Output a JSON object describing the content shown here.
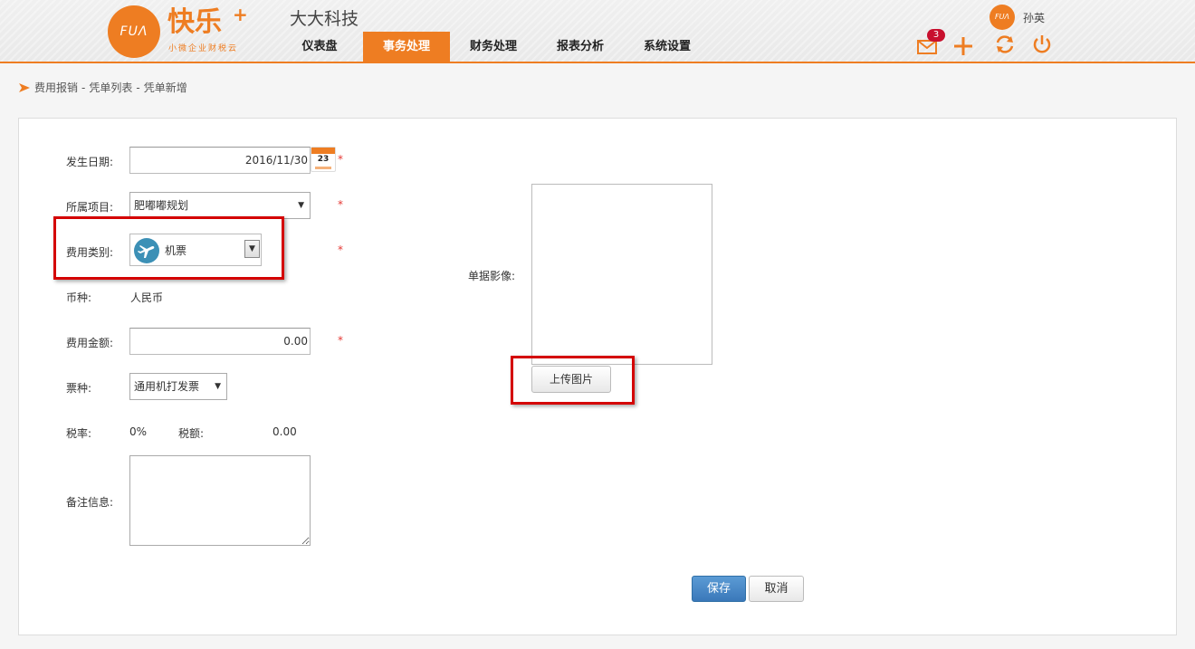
{
  "header": {
    "logo_mark": "FUΛ",
    "logo_text": "快乐",
    "logo_plus": "+",
    "logo_sub": "小微企业财税云",
    "company": "大大科技",
    "nav": [
      {
        "label": "仪表盘",
        "active": false
      },
      {
        "label": "事务处理",
        "active": true
      },
      {
        "label": "财务处理",
        "active": false
      },
      {
        "label": "报表分析",
        "active": false
      },
      {
        "label": "系统设置",
        "active": false
      }
    ],
    "user_avatar": "FUΛ",
    "user_name": "孙英",
    "mail_count": "3",
    "accent_color": "#ee7d22"
  },
  "breadcrumb": {
    "items": [
      "费用报销",
      "凭单列表",
      "凭单新增"
    ],
    "separator": "-"
  },
  "form": {
    "date_label": "发生日期:",
    "date_value": "2016/11/30",
    "calendar_day": "23",
    "project_label": "所属项目:",
    "project_value": "肥嘟嘟规划",
    "category_label": "费用类别:",
    "category_value": "机票",
    "category_icon": "airplane-icon",
    "currency_label": "币种:",
    "currency_value": "人民币",
    "amount_label": "费用金额:",
    "amount_value": "0.00",
    "ticket_label": "票种:",
    "ticket_value": "通用机打发票",
    "taxrate_label": "税率:",
    "taxrate_value": "0%",
    "tax_label": "税额:",
    "tax_value": "0.00",
    "remark_label": "备注信息:",
    "required_mark": "*",
    "image_label": "单据影像:",
    "upload_label": "上传图片",
    "save_label": "保存",
    "cancel_label": "取消"
  }
}
